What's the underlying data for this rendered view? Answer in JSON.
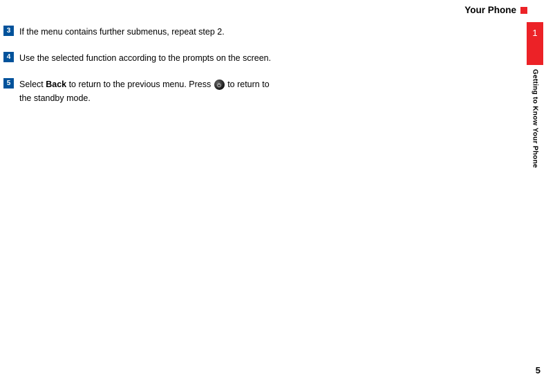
{
  "header": {
    "title": "Your Phone"
  },
  "sidebar": {
    "chapter_number": "1",
    "caption": "Getting to Know Your Phone"
  },
  "steps": [
    {
      "number": "3",
      "text_parts": [
        "If the menu contains further submenus, repeat step 2."
      ]
    },
    {
      "number": "4",
      "text_parts": [
        "Use the selected function according to the prompts on the screen."
      ]
    },
    {
      "number": "5",
      "segments": [
        {
          "type": "text",
          "value": "Select "
        },
        {
          "type": "bold",
          "value": "Back"
        },
        {
          "type": "text",
          "value": " to return to the previous menu. Press "
        },
        {
          "type": "icon",
          "value": "power-button-icon"
        },
        {
          "type": "text",
          "value": " to return to the standby mode."
        }
      ]
    }
  ],
  "page_number": "5"
}
